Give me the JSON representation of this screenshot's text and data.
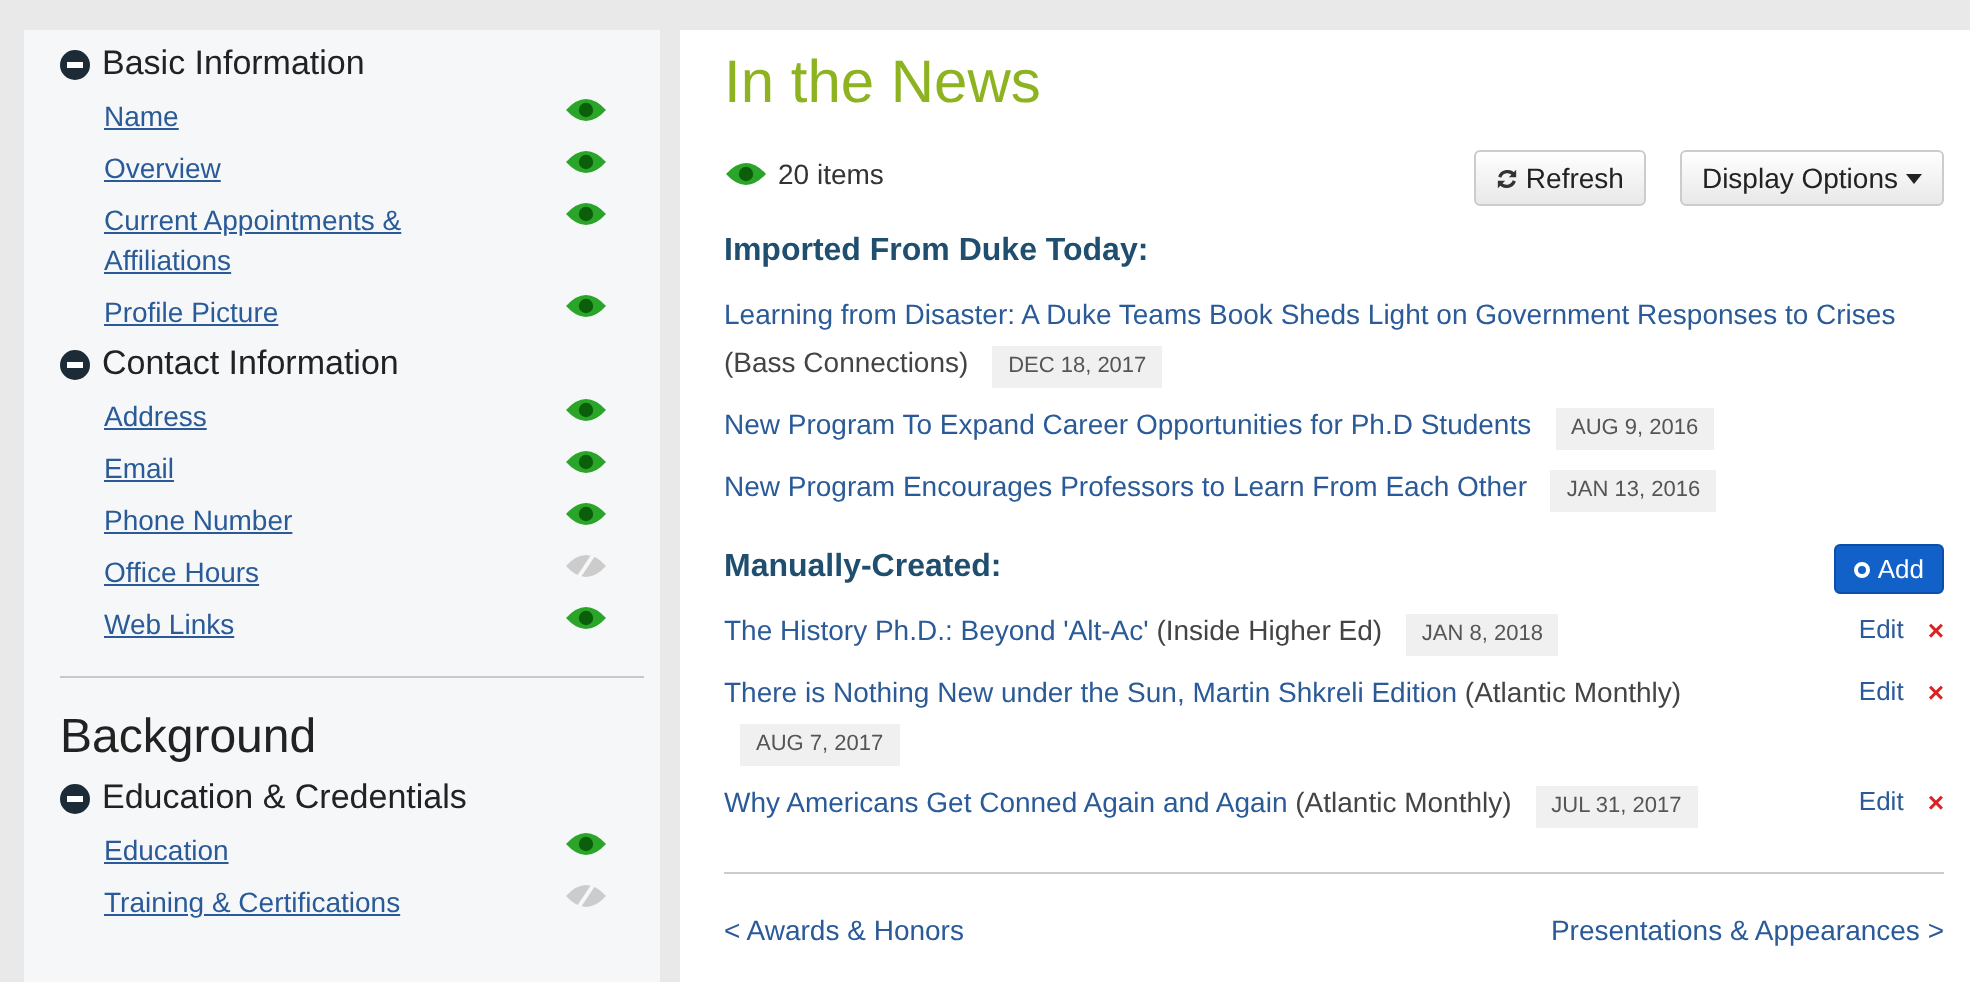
{
  "sidebar": {
    "sections": [
      {
        "groups": [
          {
            "title": "Basic Information",
            "expanded": true,
            "items": [
              {
                "label": "Name",
                "visible": true
              },
              {
                "label": "Overview",
                "visible": true
              },
              {
                "label": "Current Appointments & Affiliations",
                "visible": true
              },
              {
                "label": "Profile Picture",
                "visible": true
              }
            ]
          },
          {
            "title": "Contact Information",
            "expanded": true,
            "items": [
              {
                "label": "Address",
                "visible": true
              },
              {
                "label": "Email",
                "visible": true
              },
              {
                "label": "Phone Number",
                "visible": true
              },
              {
                "label": "Office Hours",
                "visible": false
              },
              {
                "label": "Web Links",
                "visible": true
              }
            ]
          }
        ]
      },
      {
        "heading": "Background",
        "groups": [
          {
            "title": "Education & Credentials",
            "expanded": true,
            "items": [
              {
                "label": "Education",
                "visible": true
              },
              {
                "label": "Training & Certifications",
                "visible": false
              }
            ]
          }
        ]
      }
    ]
  },
  "main": {
    "title": "In the News",
    "visible": true,
    "count": "20 items",
    "buttons": {
      "refresh": "Refresh",
      "display": "Display Options",
      "add": "Add"
    },
    "imported": {
      "heading": "Imported From Duke Today:",
      "items": [
        {
          "title": "Learning from Disaster: A Duke Teams Book Sheds Light on Government Responses to Crises",
          "source": "(Bass Connections)",
          "date": "DEC 18, 2017"
        },
        {
          "title": "New Program To Expand Career Opportunities for Ph.D Students",
          "date": "AUG 9, 2016"
        },
        {
          "title": "New Program Encourages Professors to Learn From Each Other",
          "date": "JAN 13, 2016"
        }
      ]
    },
    "manual": {
      "heading": "Manually-Created:",
      "items": [
        {
          "title": "The History Ph.D.: Beyond 'Alt-Ac'",
          "source": "(Inside Higher Ed)",
          "date": "JAN 8, 2018",
          "edit": "Edit",
          "delete": "×"
        },
        {
          "title": "There is Nothing New under the Sun, Martin Shkreli Edition",
          "source": "(Atlantic Monthly)",
          "date": "AUG 7, 2017",
          "edit": "Edit",
          "delete": "×"
        },
        {
          "title": "Why Americans Get Conned Again and Again",
          "source": "(Atlantic Monthly)",
          "date": "JUL 31, 2017",
          "edit": "Edit",
          "delete": "×"
        }
      ]
    },
    "prev": "< Awards & Honors",
    "next": "Presentations & Appearances >"
  }
}
